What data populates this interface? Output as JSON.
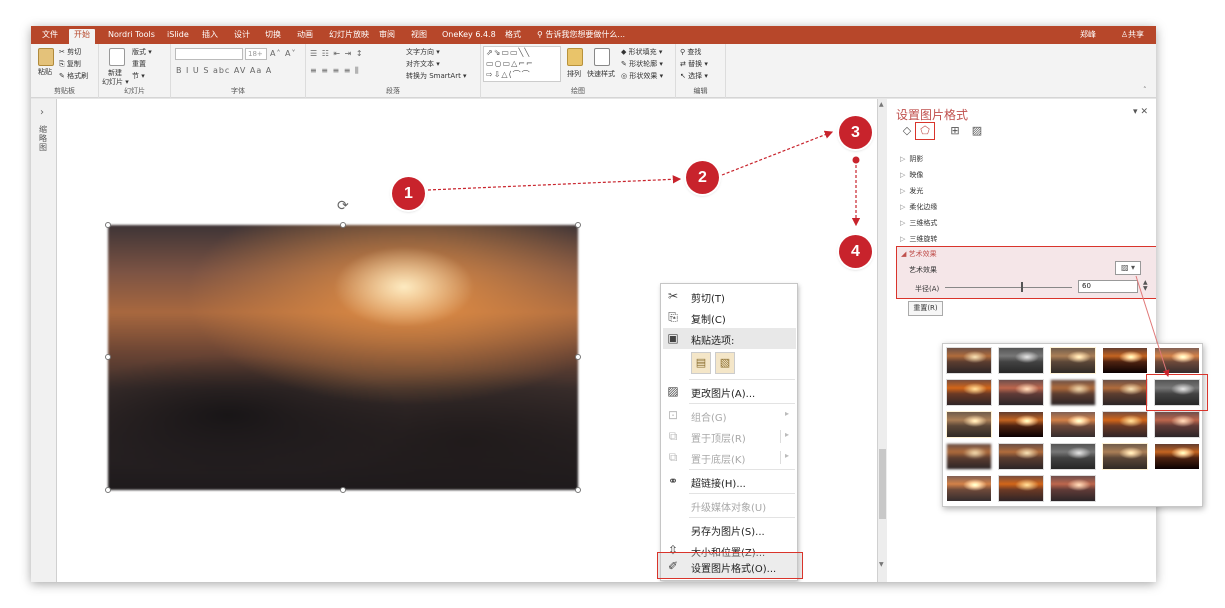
{
  "menubar": {
    "tabs": [
      "文件",
      "开始",
      "Nordri Tools",
      "iSlide",
      "插入",
      "设计",
      "切换",
      "动画",
      "幻灯片放映",
      "审阅",
      "视图",
      "OneKey 6.4.8",
      "格式"
    ],
    "active_tab": "开始",
    "tell_me": "告诉我您想要做什么...",
    "user": "郑峰",
    "share": "共享"
  },
  "ribbon": {
    "clipboard": {
      "paste": "粘贴",
      "cut": "剪切",
      "copy": "复制",
      "format_painter": "格式刷",
      "title": "剪贴板"
    },
    "slides": {
      "new_slide": "新建",
      "new_slide_sub": "幻灯片 ▾",
      "layout": "版式 ▾",
      "reset": "重置",
      "section": "节 ▾",
      "title": "幻灯片"
    },
    "font": {
      "size": "18+",
      "title": "字体"
    },
    "paragraph": {
      "text_direction": "文字方向 ▾",
      "align_text": "对齐文本 ▾",
      "smartart": "转换为 SmartArt ▾",
      "title": "段落"
    },
    "drawing": {
      "arrange": "排列",
      "quick_styles": "快速样式",
      "shape_fill": "形状填充 ▾",
      "shape_outline": "形状轮廓 ▾",
      "shape_effects": "形状效果 ▾",
      "title": "绘图"
    },
    "editing": {
      "find": "查找",
      "replace": "替换 ▾",
      "select": "选择 ▾",
      "title": "编辑"
    }
  },
  "thumbstrip": {
    "label": "缩略图"
  },
  "context_menu": {
    "items": [
      {
        "label": "剪切(T)",
        "icon": "cut-icon",
        "enabled": true
      },
      {
        "label": "复制(C)",
        "icon": "copy-icon",
        "enabled": true
      },
      {
        "label": "粘贴选项:",
        "icon": "paste-icon",
        "enabled": true
      },
      {
        "label": "更改图片(A)...",
        "icon": "change-picture-icon",
        "enabled": true
      },
      {
        "label": "组合(G)",
        "icon": "group-icon",
        "enabled": false
      },
      {
        "label": "置于顶层(R)",
        "icon": "bring-front-icon",
        "enabled": false
      },
      {
        "label": "置于底层(K)",
        "icon": "send-back-icon",
        "enabled": false
      },
      {
        "label": "超链接(H)...",
        "icon": "hyperlink-icon",
        "enabled": true
      },
      {
        "label": "升级媒体对象(U)",
        "icon": "",
        "enabled": false
      },
      {
        "label": "另存为图片(S)...",
        "icon": "",
        "enabled": true
      },
      {
        "label": "大小和位置(Z)...",
        "icon": "size-position-icon",
        "enabled": true
      },
      {
        "label": "设置图片格式(O)...",
        "icon": "format-picture-icon",
        "enabled": true
      }
    ]
  },
  "pane": {
    "title": "设置图片格式",
    "sections": [
      "阴影",
      "映像",
      "发光",
      "柔化边缘",
      "三维格式",
      "三维旋转"
    ],
    "artistic": {
      "title": "艺术效果",
      "label": "艺术效果",
      "radius_label": "半径(A)",
      "radius_value": "60",
      "radius_level": 0.6
    },
    "reset": "重置(R)"
  },
  "steps": [
    "1",
    "2",
    "3",
    "4"
  ],
  "colors": {
    "accent": "#b7472a",
    "step_red": "#c8232c",
    "highlight": "#d9342b"
  }
}
